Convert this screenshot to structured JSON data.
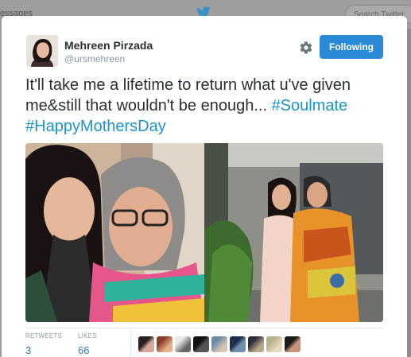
{
  "background": {
    "nav_text": "essages",
    "search_placeholder": "Search Twitter"
  },
  "tweet": {
    "author_name": "Mehreen Pirzada",
    "author_handle": "@ursmehreen",
    "follow_button_label": "Following",
    "text_line": "It'll take me a lifetime to return what u've given me&still that wouldn't be enough... ",
    "hashtag_1": "#Soulmate",
    "hashtag_2": "#HappyMothersDay",
    "retweets_label": "RETWEETS",
    "retweets_count": "3",
    "likes_label": "LIKES",
    "likes_count": "66"
  },
  "colors": {
    "accent": "#2b8ad8",
    "hashtag": "#1b95c9",
    "text": "#292f33",
    "muted": "#8899a6"
  },
  "icons": [
    "twitter-bird-icon",
    "gear-icon"
  ]
}
